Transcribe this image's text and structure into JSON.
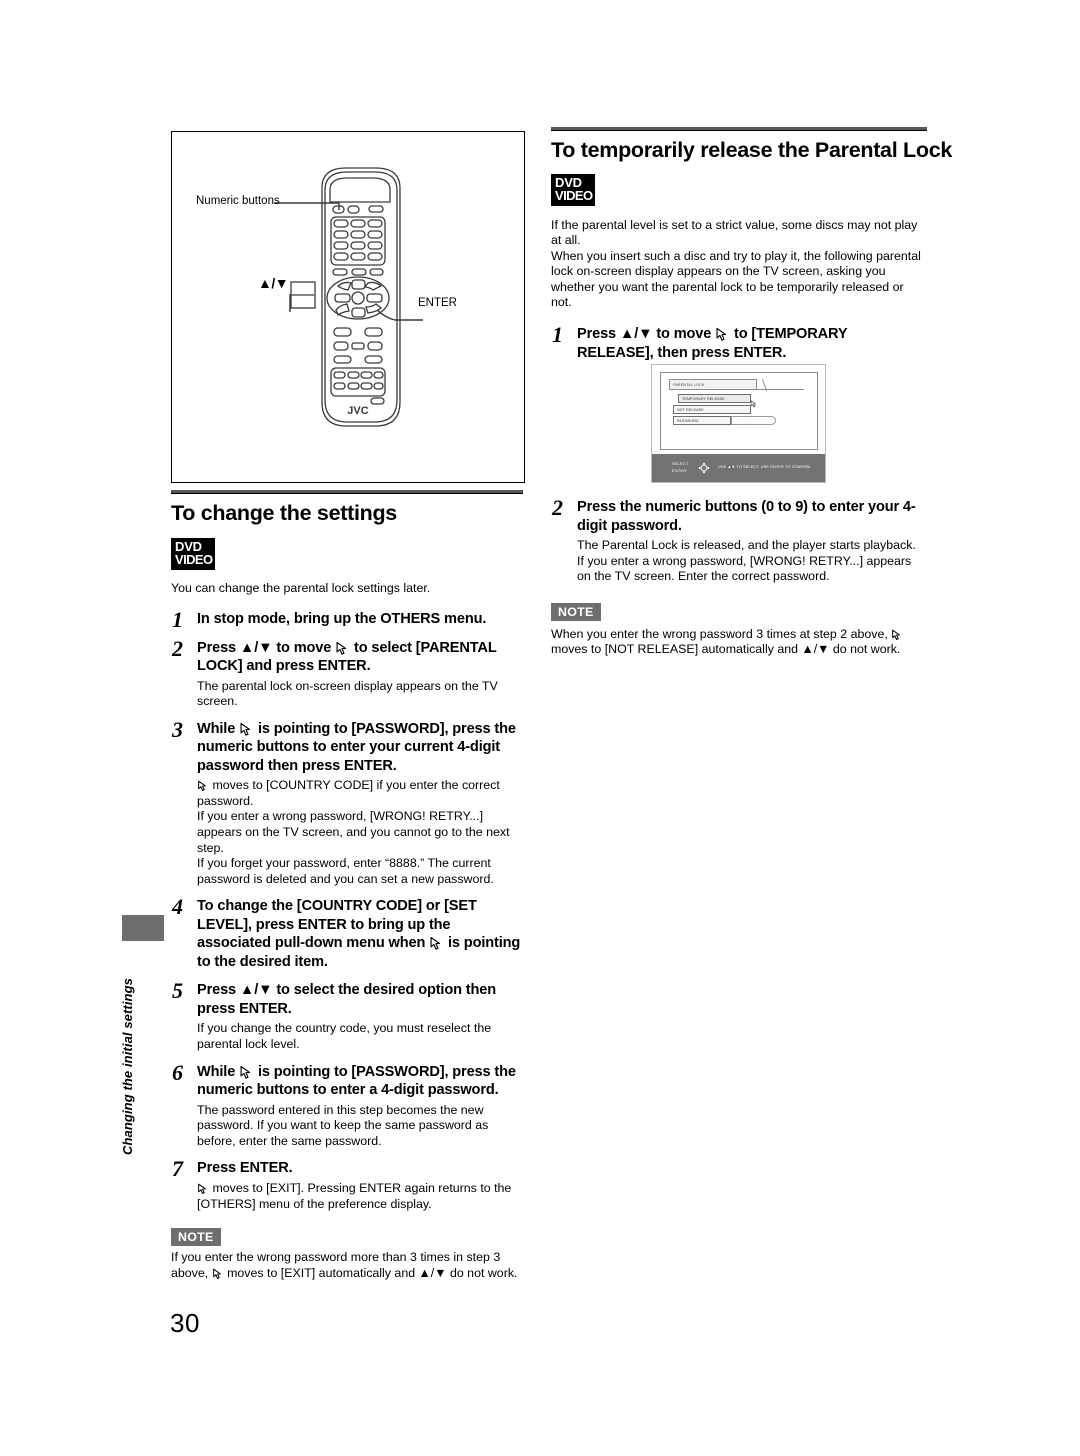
{
  "page": {
    "number": "30",
    "side_tab_label": "Changing the initial settings"
  },
  "figure_remote": {
    "label_numeric": "Numeric buttons",
    "label_updown": "5/∞",
    "label_enter": "ENTER",
    "brand": "JVC"
  },
  "left_column": {
    "title": "To change the settings",
    "logo": {
      "line1": "DVD",
      "line2": "VIDEO"
    },
    "intro": "You can change the parental lock settings later.",
    "steps": [
      {
        "num": "1",
        "head_parts": [
          "In stop mode, bring up the OTHERS menu."
        ],
        "body": ""
      },
      {
        "num": "2",
        "head_a": "Press ▲/▼ to move ",
        "head_b": " to select [PARENTAL LOCK] and press ENTER.",
        "body": "The parental lock on-screen display appears on the TV screen."
      },
      {
        "num": "3",
        "head_a": "While ",
        "head_b": " is pointing to [PASSWORD], press the numeric buttons to enter your current 4-digit password then press ENTER.",
        "body_a": " moves to [COUNTRY CODE] if you enter the correct password.",
        "body_b": "If you enter a wrong password, [WRONG! RETRY...] appears on the TV screen, and you cannot go to the next step.",
        "body_c": "If you forget your password, enter “8888.” The current password is deleted and you can set a new password."
      },
      {
        "num": "4",
        "head_a": "To change the [COUNTRY CODE] or [SET LEVEL], press ENTER to bring up the associated pull-down menu when ",
        "head_b": " is pointing to the desired item.",
        "body": ""
      },
      {
        "num": "5",
        "head_parts": [
          "Press ▲/▼ to select the desired option then press ENTER."
        ],
        "body": "If you change the country code, you must reselect the parental lock level."
      },
      {
        "num": "6",
        "head_a": "While ",
        "head_b": " is pointing to [PASSWORD], press the numeric buttons to enter a 4-digit password.",
        "body": "The password entered in this step becomes the new password. If you want to keep the same password as before, enter the same password."
      },
      {
        "num": "7",
        "head_parts": [
          "Press ENTER."
        ],
        "body_a": " moves to [EXIT]. Pressing ENTER again returns to the [OTHERS] menu of the preference display."
      }
    ],
    "note": {
      "badge": "NOTE",
      "text_a": "If you enter the wrong password more than 3 times in step 3 above, ",
      "text_b": " moves to [EXIT] automatically and ▲/▼ do not work."
    }
  },
  "right_column": {
    "title": "To temporarily release the Parental Lock",
    "logo": {
      "line1": "DVD",
      "line2": "VIDEO"
    },
    "intro_a": "If the parental level is set to a strict value, some discs may not play at all.",
    "intro_b": "When you insert such a disc and try to play it, the following parental lock on-screen display appears on the TV screen, asking you whether you want the parental lock to be temporarily released or not.",
    "steps": [
      {
        "num": "1",
        "head_a": "Press ▲/▼ to move ",
        "head_b": " to [TEMPORARY RELEASE], then press ENTER."
      },
      {
        "num": "2",
        "head_parts": [
          "Press the numeric buttons (0 to 9) to enter your 4-digit password."
        ],
        "body_a": "The Parental Lock is released, and the player starts playback.",
        "body_b": "If you enter a wrong password, [WRONG! RETRY...] appears on the TV screen. Enter the correct password."
      }
    ],
    "note": {
      "badge": "NOTE",
      "text_a": "When you enter the wrong password 3 times at step 2 above, ",
      "text_b": " moves to [NOT RELEASE] automatically and ▲/▼ do not work."
    }
  },
  "figure_osd": {
    "tab_title": "PARENTAL LOCK",
    "rows": [
      "TEMPORARY RELEASE",
      "NOT RELEASE",
      "PASSWORD"
    ],
    "password_field": "- - - -",
    "bottom_bar": {
      "select_label": "SELECT",
      "enter_label": "ENTER",
      "hint": "USE ▲▼ TO SELECT, USE ENTER TO CONFIRM"
    }
  },
  "colors": {
    "rule": "#58585a",
    "note_badge": "#6e6e70",
    "osd_bar": "#737376"
  }
}
